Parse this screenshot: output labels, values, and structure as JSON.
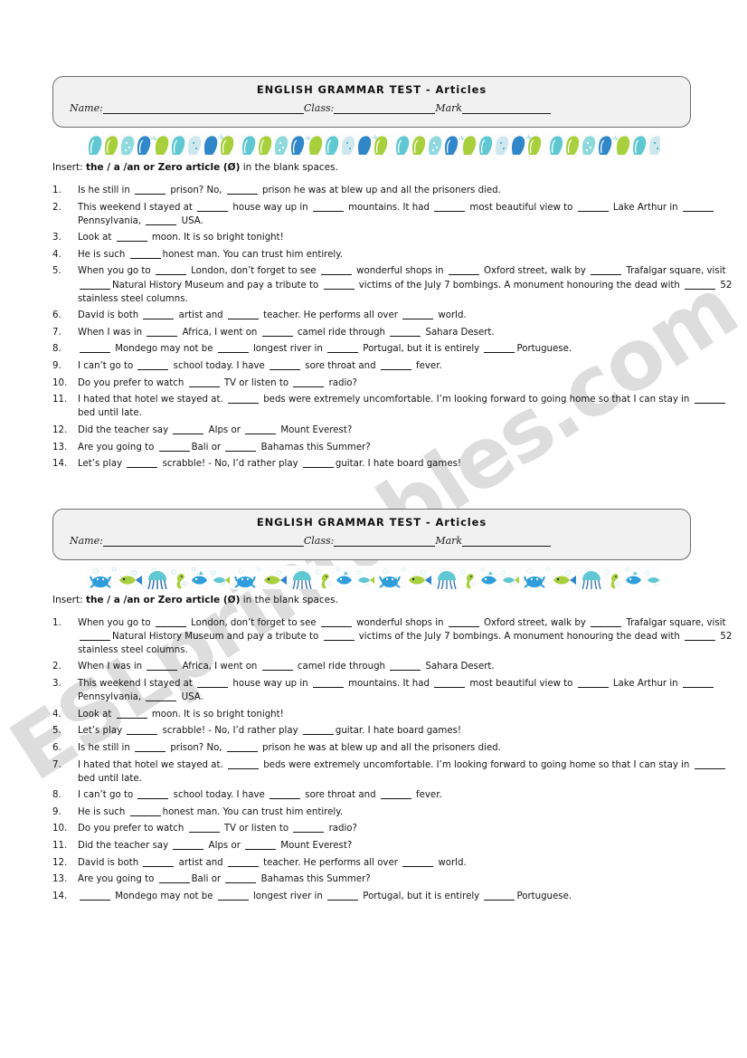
{
  "watermark": {
    "text": "ESLprintables.com",
    "color": "#c9c9c9"
  },
  "sections": [
    {
      "header": {
        "title": "ENGLISH GRAMMAR TEST - Articles",
        "name_label": "Name:",
        "class_label": "Class:",
        "mark_label": "Mark"
      },
      "border_theme": "flip-flops",
      "instruction": {
        "lead": "Insert:",
        "bold": "the / a /an or Zero article (",
        "zero_symbol": "Ø",
        "bold_end": ")",
        "tail": "in the blank spaces."
      },
      "questions": [
        "Is he still in ___ prison? No, ___ prison he was at blew up and all the prisoners died.",
        "This weekend I stayed at ___ house way up in ___ mountains. It had ___ most beautiful view to ___ Lake Arthur in ___Pennsylvania, ___ USA.",
        "Look at ___ moon. It is so bright tonight!",
        "He is such ___honest man. You can trust him entirely.",
        "When you go to ___ London, don’t forget to see ___ wonderful shops in ___ Oxford street, walk by ___ Trafalgar square, visit ___Natural History Museum and pay a tribute to ___ victims of the July 7 bombings. A monument honouring the dead with ___ 52 stainless steel columns.",
        "David is both ___ artist and ___ teacher. He performs all over ___ world.",
        "When I was in ___ Africa, I went on ___ camel ride through ___ Sahara Desert.",
        "___ Mondego may not be ___ longest river in ___ Portugal, but it is entirely ___Portuguese.",
        "I can’t go to ___ school today. I have ___ sore throat and ___ fever.",
        "Do you prefer to watch ___ TV or listen to ___ radio?",
        "I hated that hotel we stayed at. ___ beds were extremely uncomfortable.  I’m looking forward to going home so that I can stay in ___ bed until late.",
        "Did the teacher say ___ Alps or ___ Mount Everest?",
        "Are you going to ___Bali or ___ Bahamas this Summer?",
        "Let’s play ___ scrabble!  - No, I’d rather play ___guitar. I hate board games!"
      ]
    },
    {
      "header": {
        "title": "ENGLISH GRAMMAR TEST - Articles",
        "name_label": "Name:",
        "class_label": "Class:",
        "mark_label": "Mark"
      },
      "border_theme": "sea-creatures",
      "instruction": {
        "lead": "Insert:",
        "bold": "the / a /an or Zero article (",
        "zero_symbol": "Ø",
        "bold_end": ")",
        "tail": "in the blank spaces."
      },
      "questions": [
        "When you go to ___ London, don’t forget to see ___ wonderful shops in ___ Oxford street, walk by ___ Trafalgar square, visit ___Natural History Museum and pay a tribute to ___ victims of the July 7 bombings. A monument honouring the dead with ___ 52 stainless steel columns.",
        "When I was in ___ Africa, I went on ___ camel ride through ___ Sahara Desert.",
        "This weekend I stayed at ___ house way up in ___ mountains. It had ___ most beautiful view to ___ Lake Arthur in ___ Pennsylvania, ___ USA.",
        "Look at ___ moon. It is so bright tonight!",
        "Let’s play ___ scrabble!  - No, I’d rather play ___guitar. I hate board games!",
        "Is he still in ___ prison? No, ___ prison he was at blew up and all the prisoners died.",
        "I hated that hotel we stayed at. ___ beds were extremely uncomfortable.  I’m looking forward to going home so that I can stay in ___ bed until late.",
        "I can’t go to ___ school today. I have ___ sore throat and ___ fever.",
        "He is such ___honest man. You can trust him entirely.",
        "Do you prefer to watch ___ TV or listen to ___ radio?",
        "Did the teacher say ___ Alps or ___ Mount Everest?",
        "David is both ___ artist and ___ teacher. He performs all over ___ world.",
        "Are you going to ___Bali or ___ Bahamas this Summer?",
        "___ Mondego may not be ___ longest river in ___ Portugal, but it is entirely ___Portuguese."
      ]
    }
  ]
}
